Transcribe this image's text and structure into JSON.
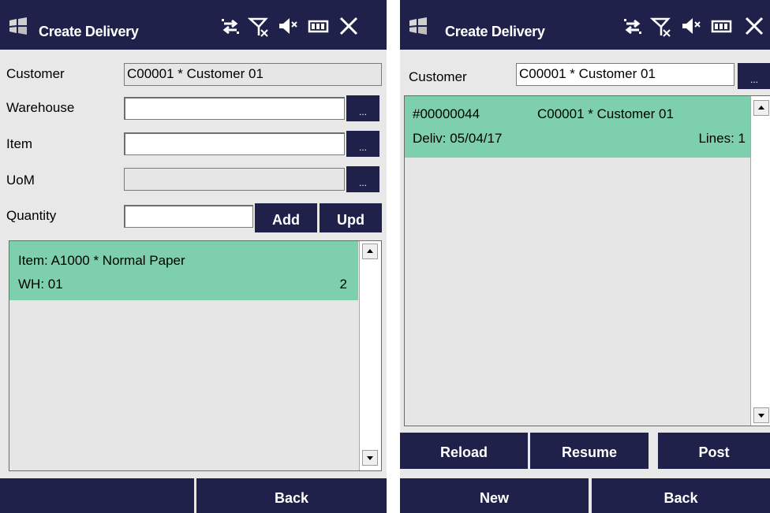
{
  "left": {
    "title": "Create Delivery",
    "form": {
      "customer_label": "Customer",
      "customer_value": "C00001 * Customer 01",
      "warehouse_label": "Warehouse",
      "warehouse_value": "",
      "item_label": "Item",
      "item_value": "",
      "uom_label": "UoM",
      "uom_value": "",
      "quantity_label": "Quantity",
      "quantity_value": "",
      "browse_label": "...",
      "add_label": "Add",
      "upd_label": "Upd"
    },
    "lines": [
      {
        "item": "Item: A1000 * Normal Paper",
        "wh": "WH: 01",
        "qty": "2"
      }
    ],
    "bottom": {
      "left_label": "",
      "back_label": "Back"
    }
  },
  "right": {
    "title": "Create Delivery",
    "customer_label": "Customer",
    "customer_value": "C00001 * Customer 01",
    "browse_label": "...",
    "deliveries": [
      {
        "number": "#00000044",
        "customer": "C00001 * Customer 01",
        "date": "Deliv: 05/04/17",
        "lines": "Lines: 1"
      }
    ],
    "buttons": {
      "reload": "Reload",
      "resume": "Resume",
      "post": "Post",
      "new": "New",
      "back": "Back"
    }
  },
  "icons": [
    "windows-logo-icon",
    "connectivity-icon",
    "no-signal-icon",
    "speaker-muted-icon",
    "battery-icon",
    "close-icon"
  ],
  "colors": {
    "titlebar": "#20214a",
    "selected_row": "#7dcfae",
    "background": "#e8e8e8"
  }
}
